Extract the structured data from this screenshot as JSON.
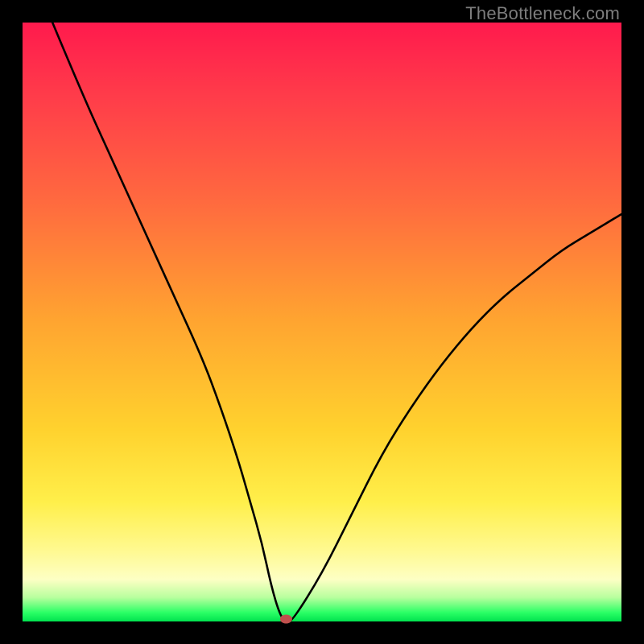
{
  "watermark": "TheBottleneck.com",
  "chart_data": {
    "type": "line",
    "title": "",
    "xlabel": "",
    "ylabel": "",
    "xlim": [
      0,
      100
    ],
    "ylim": [
      0,
      100
    ],
    "grid": false,
    "series": [
      {
        "name": "curve",
        "x": [
          5,
          10,
          15,
          20,
          25,
          30,
          33,
          36,
          38,
          40,
          41.5,
          43,
          44,
          45,
          50,
          55,
          60,
          65,
          70,
          75,
          80,
          85,
          90,
          95,
          100
        ],
        "values": [
          100,
          88,
          77,
          66,
          55,
          44,
          36,
          27,
          20,
          13,
          6,
          1,
          0,
          0,
          8,
          18,
          28,
          36,
          43,
          49,
          54,
          58,
          62,
          65,
          68
        ]
      }
    ],
    "markers": [
      {
        "name": "bottleneck-point",
        "x": 44,
        "y": 0
      }
    ],
    "background_gradient": {
      "stops": [
        {
          "pos": 0,
          "color": "#ff1a4d"
        },
        {
          "pos": 50,
          "color": "#ffa530"
        },
        {
          "pos": 88,
          "color": "#fff98f"
        },
        {
          "pos": 100,
          "color": "#00e24f"
        }
      ]
    }
  }
}
